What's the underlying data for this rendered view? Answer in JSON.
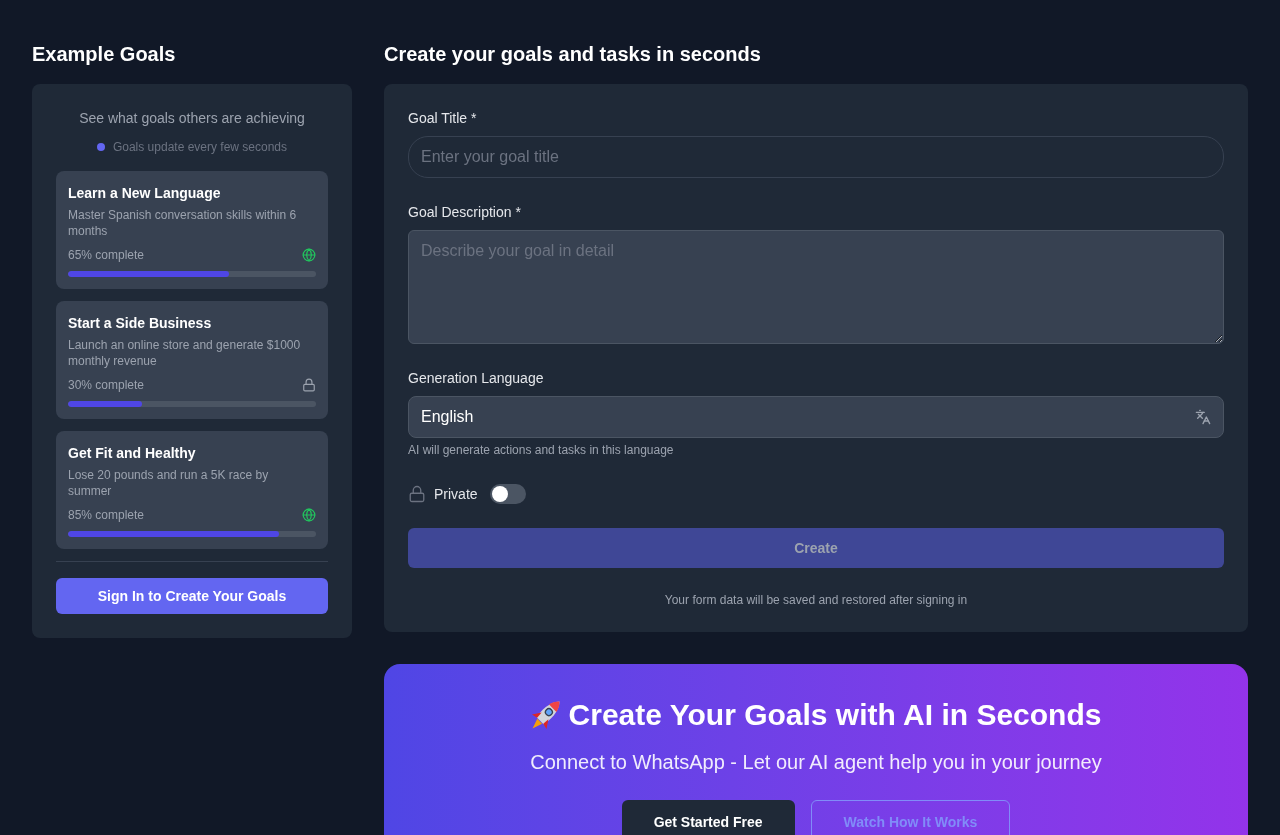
{
  "sidebar": {
    "heading": "Example Goals",
    "subtitle": "See what goals others are achieving",
    "live_note": "Goals update every few seconds",
    "goals": [
      {
        "title": "Learn a New Language",
        "description": "Master Spanish conversation skills within 6 months",
        "progress": "65% complete",
        "level": 0.65,
        "private": false
      },
      {
        "title": "Start a Side Business",
        "description": "Launch an online store and generate $1000 monthly revenue",
        "progress": "30% complete",
        "level": 0.3,
        "private": true
      },
      {
        "title": "Get Fit and Healthy",
        "description": "Lose 20 pounds and run a 5K race by summer",
        "progress": "85% complete",
        "level": 0.85,
        "private": false
      }
    ],
    "sign_in_button": "Sign In to Create Your Goals"
  },
  "form": {
    "heading": "Create your goals and tasks in seconds",
    "title_field": {
      "label": "Goal Title *",
      "placeholder": "Enter your goal title"
    },
    "description_field": {
      "label": "Goal Description *",
      "placeholder": "Describe your goal in detail"
    },
    "language_field": {
      "label": "Generation Language",
      "value": "English",
      "hint": "AI will generate actions and tasks in this language"
    },
    "private_toggle": {
      "label": "Private",
      "on": false
    },
    "create_button": {
      "label": "Create",
      "disabled": true
    },
    "footer_note": "Your form data will be saved and restored after signing in"
  },
  "banner": {
    "title": "Create Your Goals with AI in Seconds",
    "subtitle": "Connect to WhatsApp - Let our AI agent help you in your journey",
    "buttons": [
      {
        "label": "Get Started Free",
        "kind": "primary"
      },
      {
        "label": "Watch How It Works",
        "kind": "outline"
      }
    ]
  }
}
